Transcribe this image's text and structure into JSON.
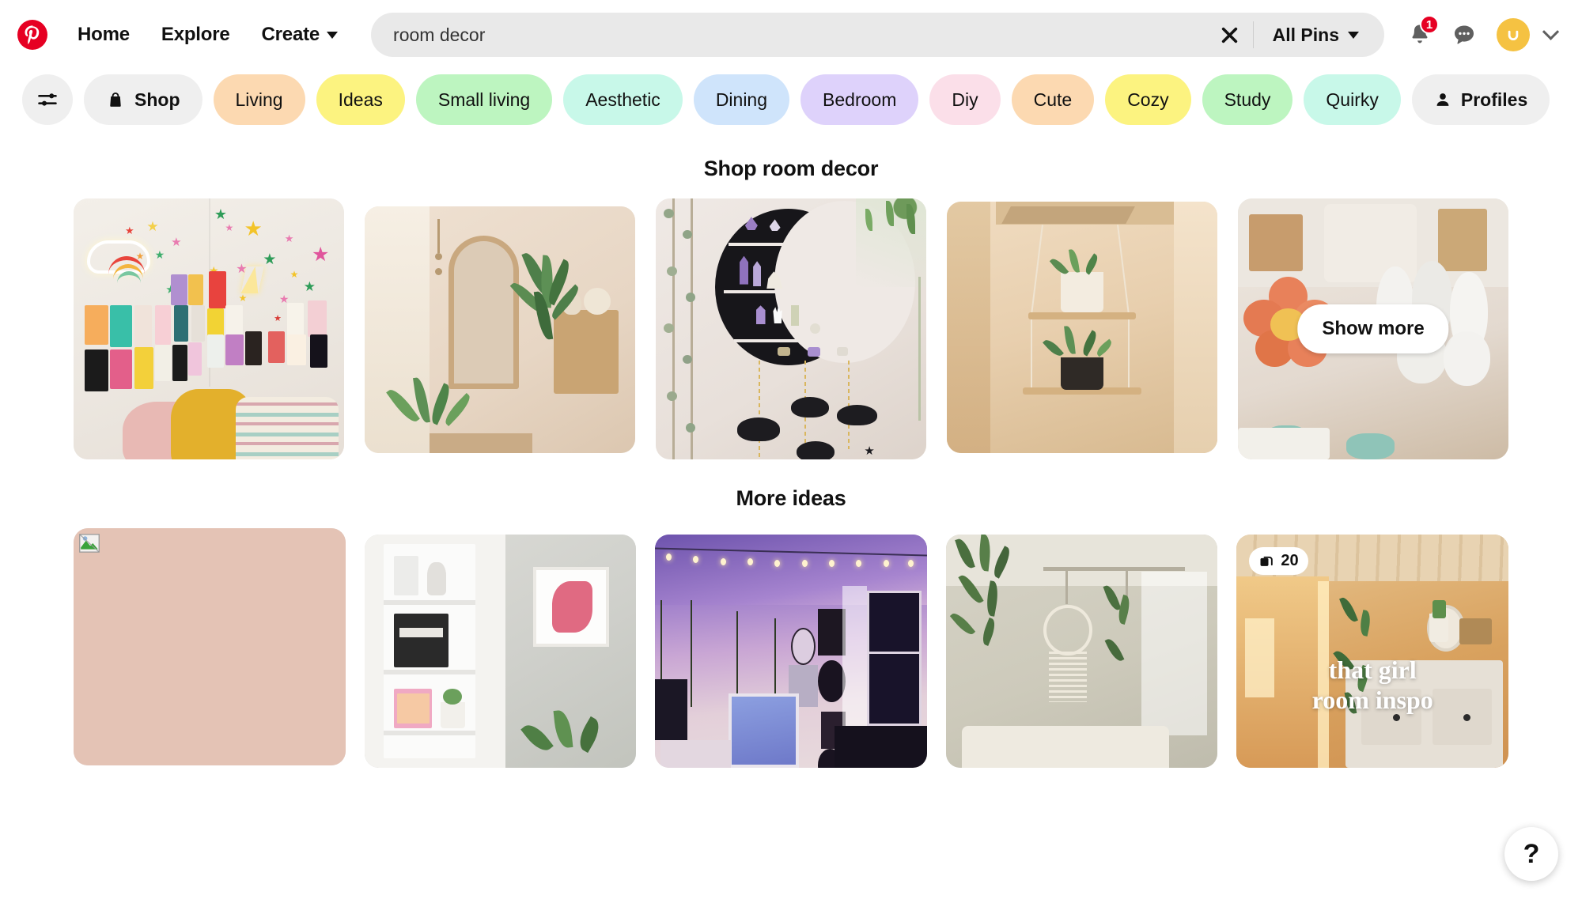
{
  "header": {
    "logo_icon": "pinterest-logo-icon",
    "nav": [
      {
        "label": "Home",
        "active": true
      },
      {
        "label": "Explore",
        "active": false
      },
      {
        "label": "Create",
        "active": false,
        "has_caret": true
      }
    ],
    "search": {
      "value": "room decor",
      "placeholder": "Search",
      "clear_icon": "close-icon",
      "scope_label": "All Pins",
      "scope_caret_icon": "chevron-down-icon"
    },
    "notifications": {
      "icon": "bell-icon",
      "badge": "1"
    },
    "messages": {
      "icon": "messages-icon"
    },
    "avatar": {
      "icon": "avatar-smiley-icon",
      "color": "#f5c242"
    },
    "account_caret": {
      "icon": "chevron-down-icon"
    }
  },
  "filters": {
    "tune_icon": "filter-sliders-icon",
    "chips": [
      {
        "label": "",
        "icon": "filter-sliders-icon",
        "color": "#efefef",
        "icon_only": true,
        "bold": false
      },
      {
        "label": "Shop",
        "icon": "shopping-bag-icon",
        "color": "#efefef",
        "icon_only": false,
        "bold": true
      },
      {
        "label": "Living",
        "icon": "",
        "color": "#fcd9b1",
        "icon_only": false,
        "bold": false
      },
      {
        "label": "Ideas",
        "icon": "",
        "color": "#fcf380",
        "icon_only": false,
        "bold": false
      },
      {
        "label": "Small living",
        "icon": "",
        "color": "#bdf5c0",
        "icon_only": false,
        "bold": false
      },
      {
        "label": "Aesthetic",
        "icon": "",
        "color": "#c8f8e9",
        "icon_only": false,
        "bold": false
      },
      {
        "label": "Dining",
        "icon": "",
        "color": "#cfe4fb",
        "icon_only": false,
        "bold": false
      },
      {
        "label": "Bedroom",
        "icon": "",
        "color": "#ded2fb",
        "icon_only": false,
        "bold": false
      },
      {
        "label": "Diy",
        "icon": "",
        "color": "#fbdfe9",
        "icon_only": false,
        "bold": false
      },
      {
        "label": "Cute",
        "icon": "",
        "color": "#fcd9b1",
        "icon_only": false,
        "bold": false
      },
      {
        "label": "Cozy",
        "icon": "",
        "color": "#fcf380",
        "icon_only": false,
        "bold": false
      },
      {
        "label": "Study",
        "icon": "",
        "color": "#bdf5c0",
        "icon_only": false,
        "bold": false
      },
      {
        "label": "Quirky",
        "icon": "",
        "color": "#c8f8e9",
        "icon_only": false,
        "bold": false
      },
      {
        "label": "Profiles",
        "icon": "person-icon",
        "color": "#efefef",
        "icon_only": false,
        "bold": true
      }
    ]
  },
  "shop_section": {
    "title": "Shop room decor",
    "show_more_label": "Show more",
    "cards": [
      {
        "alt": "dorm wall collage with neon cloud rainbow star decals and pillows"
      },
      {
        "alt": "boho bedroom corner with arched mirror curtains and plants"
      },
      {
        "alt": "black crescent moon crystal shelf with hanging cloud garland"
      },
      {
        "alt": "hanging macrame wood shelf with potted plants in warm light"
      },
      {
        "alt": "plush flower and cloud cushions on floor"
      }
    ]
  },
  "ideas_section": {
    "title": "More ideas",
    "cards": [
      {
        "alt": "image failed to load placeholder",
        "broken": true,
        "bg": "#e4c3b5",
        "badge": "",
        "overlay": ""
      },
      {
        "alt": "white corner shelf with books prints and monstera plant",
        "broken": false,
        "bg": "#d8d9d4",
        "badge": "",
        "overlay": ""
      },
      {
        "alt": "purple galaxy bedroom with fairy lights records and posters",
        "broken": false,
        "bg": "#9a7fc7",
        "badge": "",
        "overlay": ""
      },
      {
        "alt": "white boho bedroom with hanging plants and macrame",
        "broken": false,
        "bg": "#cfcec2",
        "badge": "",
        "overlay": ""
      },
      {
        "alt": "warm sunset bedroom with mirror and dresser",
        "broken": false,
        "bg": "#d8a46a",
        "badge": "20",
        "overlay": "that girl\nroom inspo"
      }
    ],
    "badge_icon": "carousel-stack-icon"
  },
  "help": {
    "label": "?",
    "icon": "question-mark-icon"
  },
  "colors": {
    "brand_red": "#e60023",
    "text": "#111111",
    "search_bg": "#e9e9e9",
    "chip_neutral": "#efefef"
  }
}
